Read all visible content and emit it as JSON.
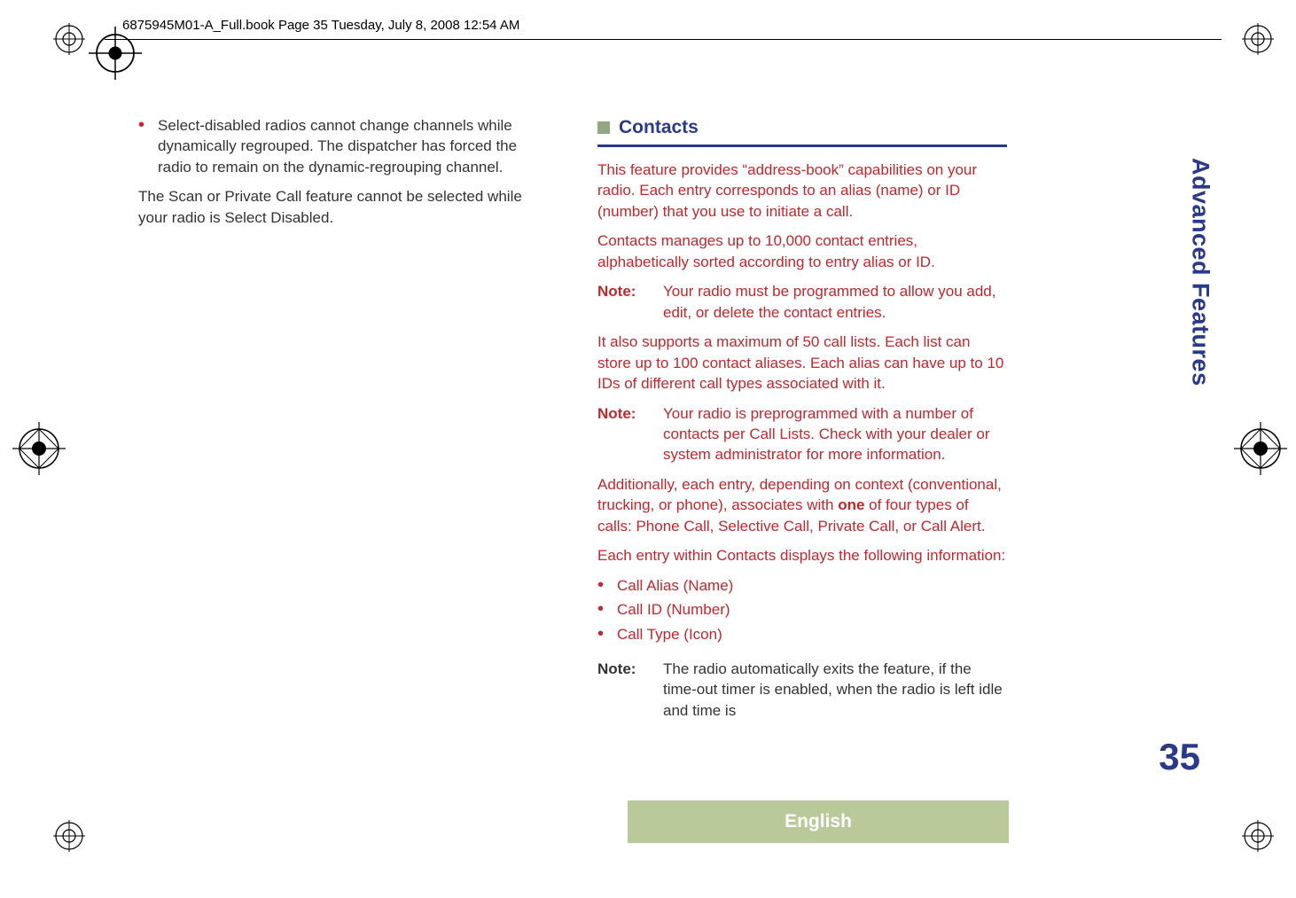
{
  "header_meta": "6875945M01-A_Full.book  Page 35  Tuesday, July 8, 2008  12:54 AM",
  "left_col": {
    "bullet": "Select-disabled radios cannot change channels while dynamically regrouped. The dispatcher has forced the radio to remain on the dynamic-regrouping channel.",
    "para": "The Scan or Private Call feature cannot be selected while your radio is Select Disabled."
  },
  "right_col": {
    "section_title": "Contacts",
    "p1": "This feature provides “address-book” capabilities on your radio. Each entry corresponds to an alias (name) or ID (number) that you use to initiate a call.",
    "p2": "Contacts manages up to 10,000 contact entries, alphabetically sorted according to entry alias or ID.",
    "note1_label": "Note:",
    "note1_body": "Your radio must be programmed to allow you add, edit, or delete the contact entries.",
    "p3": "It also supports a maximum of 50 call lists. Each list can store up to 100 contact aliases. Each alias can have up to 10 IDs of different call types associated with it.",
    "note2_label": "Note:",
    "note2_body": "Your radio is preprogrammed with a number of contacts per Call Lists. Check with your dealer or system administrator for more information.",
    "p4_pre": "Additionally, each entry, depending on context (conventional, trucking, or phone), associates with ",
    "p4_bold": "one",
    "p4_post": " of four types of calls: Phone Call, Selective Call, Private Call, or Call Alert.",
    "p5": "Each entry within Contacts displays the following information:",
    "li1": "Call Alias (Name)",
    "li2": "Call ID (Number)",
    "li3": "Call Type (Icon)",
    "note3_label": "Note:",
    "note3_body": "The radio automatically exits the feature, if the time-out timer is enabled, when the radio is left idle and time is"
  },
  "side_tab": "Advanced Features",
  "page_number": "35",
  "footer_lang": "English"
}
